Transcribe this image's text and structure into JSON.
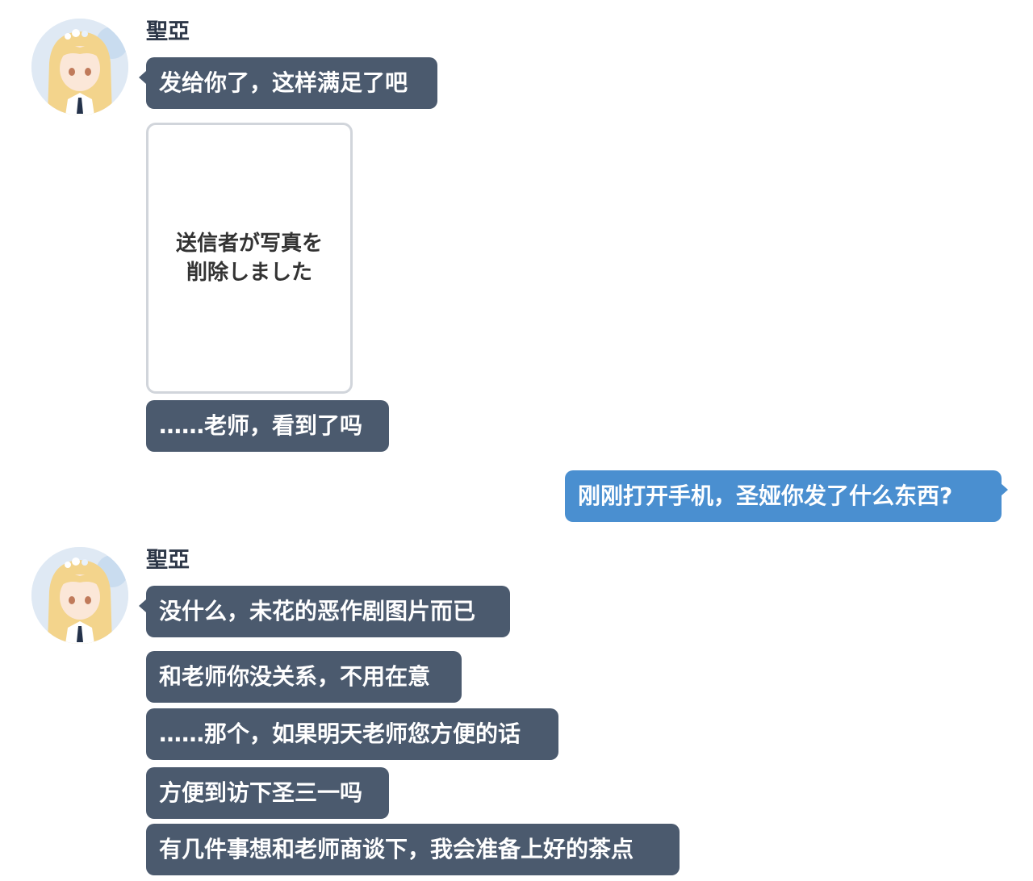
{
  "conversation": {
    "groups": [
      {
        "sender": "聖亞",
        "messages": [
          "发给你了，这样满足了吧",
          "……老师，看到了吗"
        ],
        "deleted_photo_text": "送信者が写真を\n削除しました"
      },
      {
        "sender": "聖亞",
        "messages": [
          "没什么，未花的恶作剧图片而已",
          "和老师你没关系，不用在意",
          "……那个，如果明天老师您方便的话",
          "方便到访下圣三一吗",
          "有几件事想和老师商谈下，我会准备上好的茶点"
        ]
      }
    ],
    "outgoing": [
      "刚刚打开手机，圣娅你发了什么东西?"
    ]
  },
  "colors": {
    "incoming_bubble": "#4b5a6e",
    "outgoing_bubble": "#4a8fd0",
    "avatar_hair": "#f3d48c",
    "avatar_bg": "#dfe9f4"
  },
  "icons": {
    "avatar": "anime-girl-avatar-icon"
  }
}
